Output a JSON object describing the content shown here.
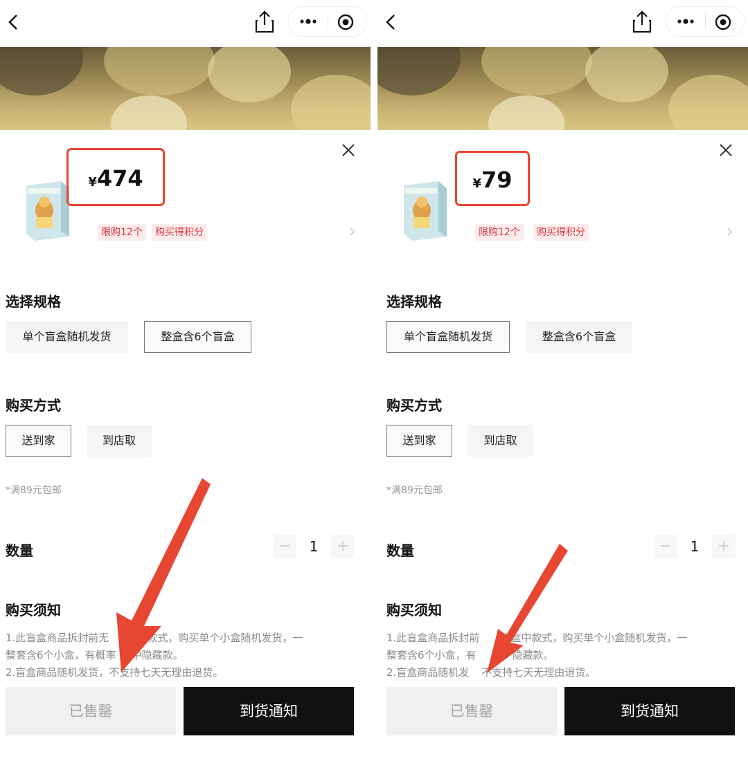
{
  "panels": [
    {
      "price": {
        "currency": "¥",
        "amount": "474"
      },
      "tags": [
        "限购12个",
        "购买得积分"
      ],
      "spec": {
        "title": "选择规格",
        "options": [
          "单个盲盒随机发货",
          "整盒含6个盲盒"
        ],
        "selected_index": 1
      },
      "purchase": {
        "title": "购买方式",
        "options": [
          "送到家",
          "到店取"
        ],
        "selected_index": 0
      },
      "shipping_note": "*满89元包邮",
      "quantity": {
        "label": "数量",
        "value": "1",
        "minus": "−",
        "plus": "+"
      },
      "notice": {
        "title": "购买须知",
        "line1a": "1.此盲盒商品拆封前无",
        "line1b": "中款式，购买单个小盒随机发货，一",
        "line2a": "整套含6个小盒，有概率",
        "line2b": "中隐藏款。",
        "line3a": "2.盲盒商品随机发货，",
        "line3b": "不支持七天无理由退货。"
      },
      "buttons": {
        "soldout": "已售罄",
        "notify": "到货通知"
      }
    },
    {
      "price": {
        "currency": "¥",
        "amount": "79"
      },
      "tags": [
        "限购12个",
        "购买得积分"
      ],
      "spec": {
        "title": "选择规格",
        "options": [
          "单个盲盒随机发货",
          "整盒含6个盲盒"
        ],
        "selected_index": 0
      },
      "purchase": {
        "title": "购买方式",
        "options": [
          "送到家",
          "到店取"
        ],
        "selected_index": 0
      },
      "shipping_note": "*满89元包邮",
      "quantity": {
        "label": "数量",
        "value": "1",
        "minus": "−",
        "plus": "+"
      },
      "notice": {
        "title": "购买须知",
        "line1a": "1.此盲盒商品拆封前",
        "line1b": "晓盒中款式，购买单个小盒随机发货，一",
        "line2a": "整套含6个小盒，有",
        "line2b": "隐藏款。",
        "line3a": "2.盲盒商品随机发",
        "line3b": "不支持七天无理由退货。"
      },
      "buttons": {
        "soldout": "已售罄",
        "notify": "到货通知"
      }
    }
  ],
  "colors": {
    "highlight_red": "#e64632",
    "tag_text": "#d9363e",
    "tag_bg": "#fdeceb",
    "notify_bg": "#111111",
    "soldout_bg": "#f0f0f0"
  },
  "icons": [
    "back-icon",
    "share-icon",
    "more-icon",
    "target-icon",
    "close-icon",
    "chevron-right-icon",
    "annotation-arrow"
  ]
}
